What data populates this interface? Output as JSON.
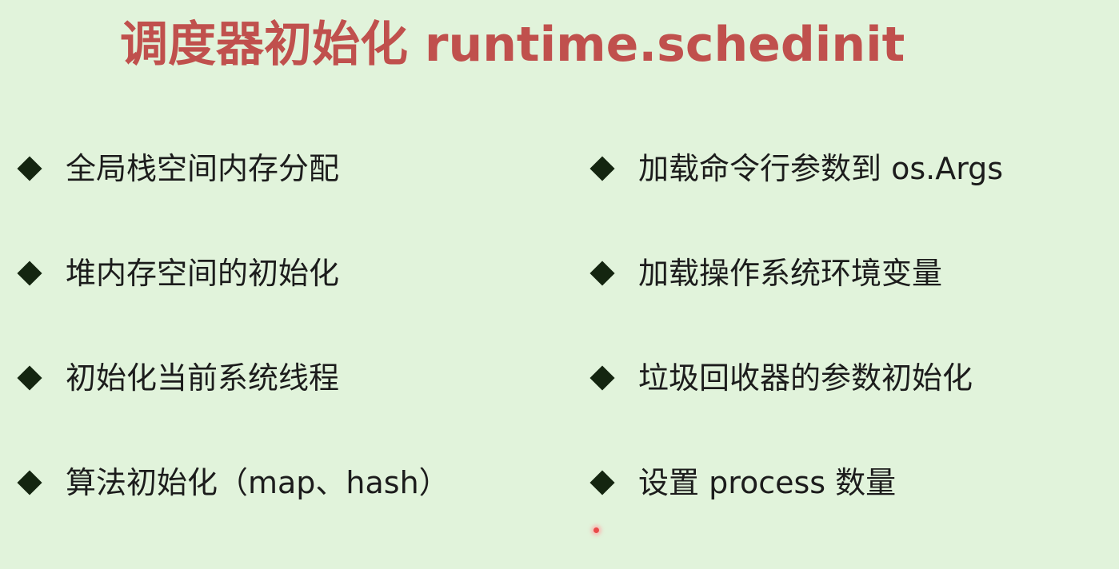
{
  "slide": {
    "title": "调度器初始化 runtime.schedinit",
    "left_column": [
      {
        "text": "全局栈空间内存分配"
      },
      {
        "text": "堆内存空间的初始化"
      },
      {
        "text": "初始化当前系统线程"
      },
      {
        "text": "算法初始化（map、hash）"
      }
    ],
    "right_column": [
      {
        "text": "加载命令行参数到 os.Args"
      },
      {
        "text": "加载操作系统环境变量"
      },
      {
        "text": "垃圾回收器的参数初始化"
      },
      {
        "text": "设置 process 数量"
      }
    ]
  },
  "colors": {
    "background": "#e1f3db",
    "title": "#c0504d",
    "bullet_marker": "#142510",
    "body_text": "#1c1c1c",
    "pointer": "#e94a4a"
  },
  "icons": {
    "bullet": "diamond-bullet-icon",
    "pointer": "laser-pointer-icon"
  }
}
